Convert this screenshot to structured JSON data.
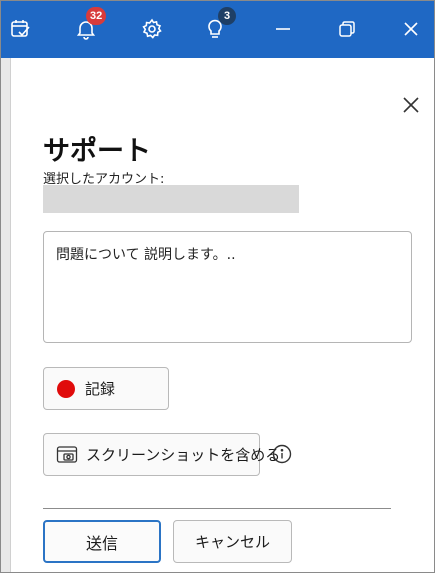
{
  "titlebar": {
    "icons": [
      "tasks-icon",
      "bell-icon",
      "gear-icon",
      "lightbulb-icon",
      "minimize-icon",
      "restore-icon",
      "close-icon"
    ],
    "notifications_count": "32",
    "tips_count": "3",
    "color": "#1f68c4"
  },
  "support_panel": {
    "title": "サポート",
    "account_label": "選択したアカウント:",
    "description_placeholder": "問題について 説明します。..",
    "record_label": "記録",
    "screenshot_label": "スクリーンショットを含める",
    "send_label": "送信",
    "cancel_label": "キャンセル"
  },
  "colors": {
    "accent": "#2b74c5",
    "record_dot": "#e00b0b"
  }
}
